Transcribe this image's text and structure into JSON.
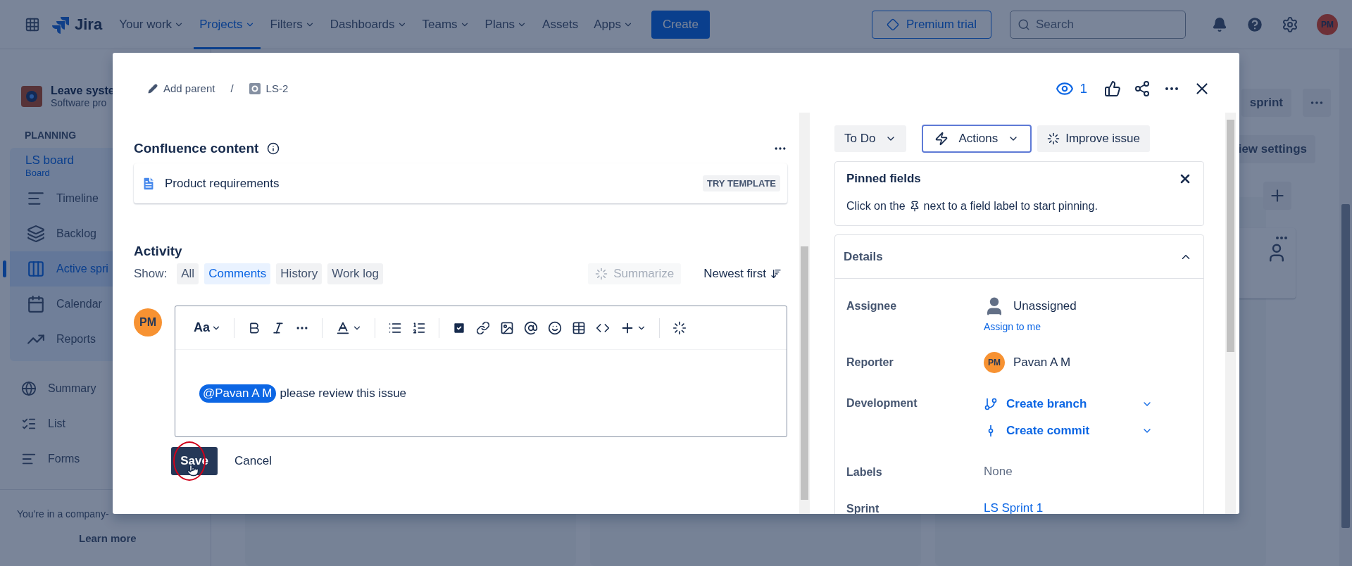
{
  "top_nav": {
    "product": "Jira",
    "menu": [
      {
        "label": "Your work",
        "selected": false,
        "has_menu": true
      },
      {
        "label": "Projects",
        "selected": true,
        "has_menu": true
      },
      {
        "label": "Filters",
        "selected": false,
        "has_menu": true
      },
      {
        "label": "Dashboards",
        "selected": false,
        "has_menu": true
      },
      {
        "label": "Teams",
        "selected": false,
        "has_menu": true
      },
      {
        "label": "Plans",
        "selected": false,
        "has_menu": true
      },
      {
        "label": "Assets",
        "selected": false,
        "has_menu": false
      },
      {
        "label": "Apps",
        "selected": false,
        "has_menu": true
      }
    ],
    "create": "Create",
    "premium": "Premium trial",
    "search": {
      "placeholder": "Search"
    },
    "avatar": "PM"
  },
  "sidebar": {
    "project": {
      "name": "Leave syste",
      "type": "Software pro"
    },
    "section": "PLANNING",
    "board": {
      "name": "LS board",
      "type": "Board"
    },
    "board_items": [
      {
        "label": "Timeline",
        "selected": false
      },
      {
        "label": "Backlog",
        "selected": false
      },
      {
        "label": "Active spri",
        "selected": true
      },
      {
        "label": "Calendar",
        "selected": false
      },
      {
        "label": "Reports",
        "selected": false
      }
    ],
    "items": [
      {
        "label": "Summary",
        "selected": false
      },
      {
        "label": "List",
        "selected": false
      },
      {
        "label": "Forms",
        "selected": false
      }
    ],
    "footer": {
      "text": "You're in a company-",
      "link": "Learn more"
    }
  },
  "board": {
    "buttons": [
      "sprint",
      "iew settings"
    ]
  },
  "issue": {
    "breadcrumb": {
      "add_parent": "Add parent",
      "separator": "/",
      "key": "LS-2"
    },
    "watchers": "1",
    "confluence": {
      "title": "Confluence content",
      "page": "Product requirements",
      "action": "TRY TEMPLATE"
    },
    "activity": {
      "title": "Activity",
      "show_label": "Show:",
      "tabs": [
        {
          "label": "All",
          "selected": false
        },
        {
          "label": "Comments",
          "selected": true
        },
        {
          "label": "History",
          "selected": false
        },
        {
          "label": "Work log",
          "selected": false
        }
      ],
      "summarize": {
        "label": "Summarize",
        "disabled": true
      },
      "sort": "Newest first",
      "avatar": "PM",
      "text_style": "Aa",
      "comment": {
        "mention": "@Pavan A M",
        "text": "please review this issue"
      },
      "save": "Save",
      "cancel": "Cancel"
    },
    "status": "To Do",
    "actions": "Actions",
    "improve": "Improve issue",
    "pinned": {
      "title": "Pinned fields",
      "hint_before": "Click on the",
      "hint_after": "next to a field label to start pinning."
    },
    "details": {
      "title": "Details",
      "expanded": true,
      "rows": [
        {
          "label": "Assignee",
          "kind": "unassigned",
          "value": "Unassigned",
          "action": "Assign to me"
        },
        {
          "label": "Reporter",
          "kind": "user",
          "value": "Pavan A M",
          "initials": "PM"
        },
        {
          "label": "Development",
          "kind": "actions",
          "actions": [
            "Create branch",
            "Create commit"
          ]
        },
        {
          "label": "Labels",
          "kind": "empty",
          "value": "None"
        },
        {
          "label": "Sprint",
          "kind": "link",
          "value": "LS Sprint 1"
        }
      ]
    }
  }
}
